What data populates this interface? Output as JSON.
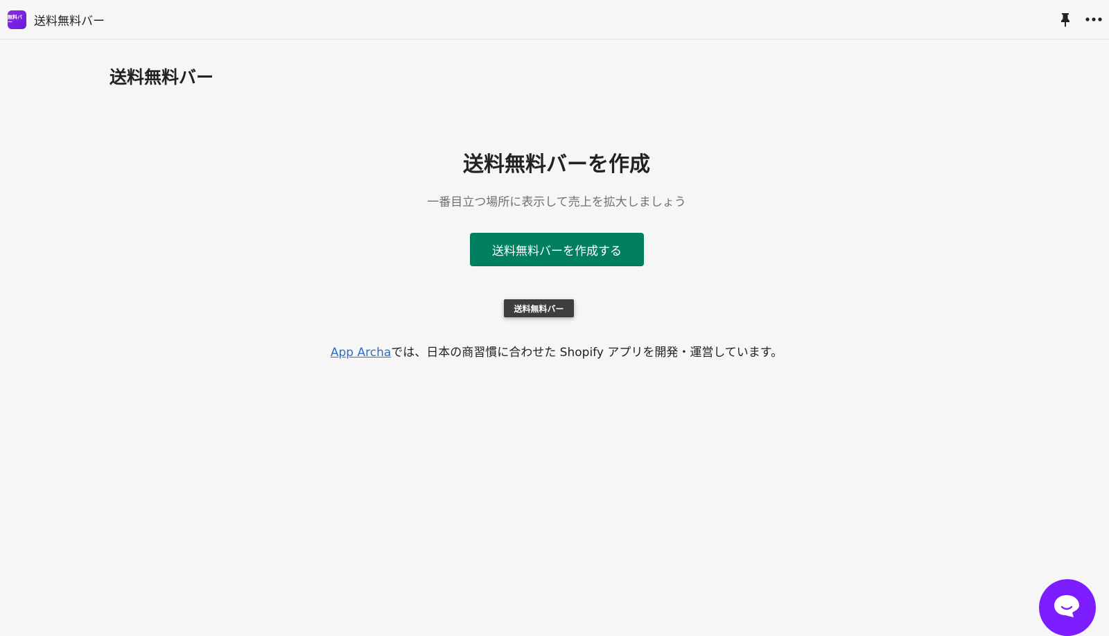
{
  "header": {
    "app_icon_text": "無料バー",
    "app_name": "送料無料バー",
    "pin_icon": "pin-icon",
    "more_icon": "more-horizontal-icon"
  },
  "page": {
    "title": "送料無料バー"
  },
  "hero": {
    "title": "送料無料バーを作成",
    "subtitle": "一番目立つ場所に表示して売上を拡大しましょう",
    "button_label": "送料無料バーを作成する"
  },
  "badge": {
    "label": "送料無料バー"
  },
  "footer": {
    "link_text": "App Archa",
    "text": "では、日本の商習慣に合わせた Shopify アプリを開発・運営しています。"
  },
  "chat": {
    "icon": "chat-bubble-icon",
    "color": "#7c1dff"
  },
  "colors": {
    "primary_button": "#008060",
    "link": "#2c6ecb",
    "background": "#f6f6f7"
  }
}
